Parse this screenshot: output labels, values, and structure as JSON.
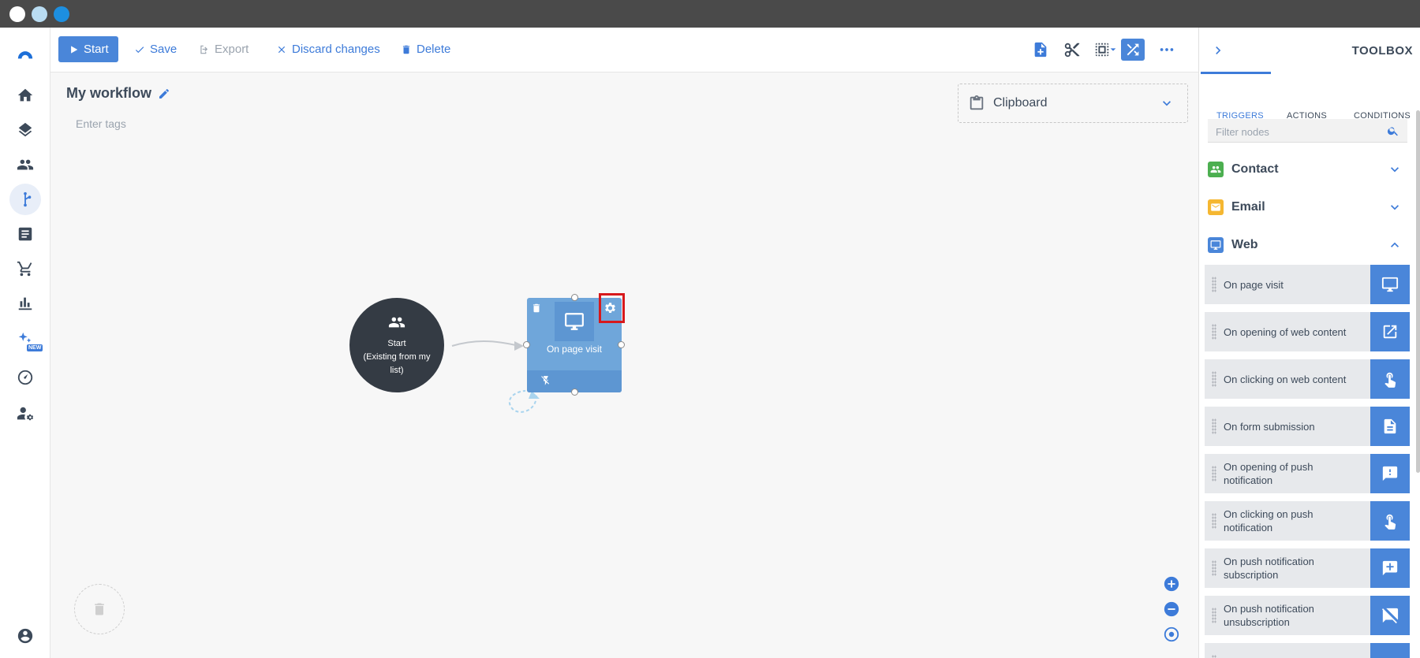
{
  "toolbar": {
    "start": "Start",
    "save": "Save",
    "export": "Export",
    "discard": "Discard changes",
    "delete": "Delete"
  },
  "workflow": {
    "title": "My workflow",
    "tags_placeholder": "Enter tags"
  },
  "clipboard": {
    "label": "Clipboard"
  },
  "start_node": {
    "label": "Start",
    "sublabel": "(Existing from my list)"
  },
  "trigger_node": {
    "label": "On page visit"
  },
  "toolbox": {
    "title": "TOOLBOX",
    "tabs": [
      "TRIGGERS",
      "ACTIONS",
      "CONDITIONS"
    ],
    "active_tab": "TRIGGERS",
    "filter_placeholder": "Filter nodes",
    "categories": [
      {
        "label": "Contact",
        "color": "#4caf50",
        "expanded": false
      },
      {
        "label": "Email",
        "color": "#f5b731",
        "expanded": false
      },
      {
        "label": "Web",
        "color": "#4a86d9",
        "expanded": true
      }
    ],
    "items": [
      {
        "label": "On page visit",
        "icon": "monitor-icon"
      },
      {
        "label": "On opening of web content",
        "icon": "open-external-icon"
      },
      {
        "label": "On clicking on web content",
        "icon": "touch-icon"
      },
      {
        "label": "On form submission",
        "icon": "document-icon"
      },
      {
        "label": "On opening of push notification",
        "icon": "notification-alert-icon"
      },
      {
        "label": "On clicking on push notification",
        "icon": "touch-icon"
      },
      {
        "label": "On push notification subscription",
        "icon": "message-plus-icon"
      },
      {
        "label": "On push notification unsubscription",
        "icon": "message-off-icon"
      }
    ]
  },
  "colors": {
    "accent": "#4a86d9",
    "node_bg": "#6fa6da",
    "start_node_bg": "#343b44",
    "highlight": "#d7191c"
  }
}
